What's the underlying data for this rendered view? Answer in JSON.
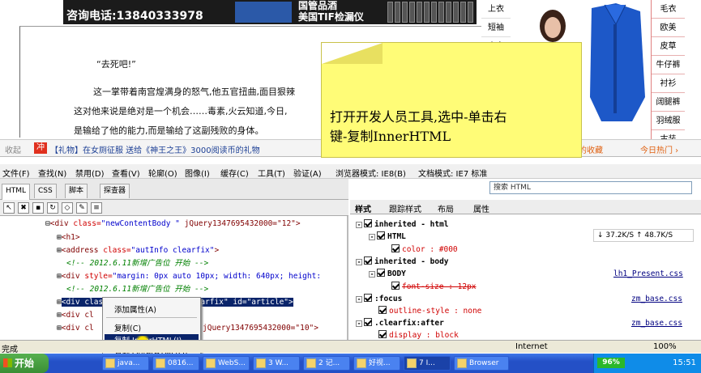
{
  "banner": {
    "phone": "咨询电话:13840333978",
    "text_line1": "国管品酒",
    "text_line2": "美国TIF检漏仪"
  },
  "article": {
    "quote": "“去死吧!”",
    "line1": "这一掌带着南宫煌满身的怒气,他五官扭曲,面目狠辣",
    "line2": "这对他来说是绝对是一个机会……毒素,火云知道,今日,",
    "line3": "是输给了他的能力,而是输给了这副残败的身体。"
  },
  "right_ad": {
    "categories": [
      "上衣",
      "短袖",
      "大衣"
    ],
    "menu": [
      "毛衣",
      "欧美",
      "皮草",
      "牛仔裤",
      "衬衫",
      "阔腿裤",
      "羽绒服",
      "古装"
    ]
  },
  "game_bar": {
    "shou": "收起",
    "chong": "冲",
    "gift_text": "【礼物】在女厕征服 送给《神王之王》3000阅读币的礼物",
    "favorites": "我的收藏",
    "today_hot": "今日热门 ›"
  },
  "devtools": {
    "menu": [
      "文件(F)",
      "查找(N)",
      "禁用(D)",
      "查看(V)",
      "轮廓(O)",
      "图像(I)",
      "缓存(C)",
      "工具(T)",
      "验证(A)",
      "浏览器模式: IE8(B)",
      "文档模式: IE7 标准"
    ],
    "tabs": [
      "HTML",
      "CSS",
      "脚本",
      "探查器"
    ],
    "search_placeholder": "搜索 HTML",
    "right_tabs": [
      "样式",
      "跟踪样式",
      "布局",
      "属性"
    ],
    "dom_lines": [
      {
        "prefix": "⊟",
        "tag": "<div ",
        "attr": "class=",
        "val": "\"newContentBody \"",
        "rest": " jQuery1347695432000=\"12\">"
      },
      {
        "prefix": "⊞",
        "tag": "<h1>",
        "attr": "",
        "val": "",
        "rest": ""
      },
      {
        "prefix": "⊞",
        "tag": "<address ",
        "attr": "class=",
        "val": "\"autInfo clearfix\"",
        "rest": ">"
      },
      {
        "prefix": "",
        "tag": "",
        "attr": "",
        "val": "",
        "rest": "<!-- 2012.6.11新增广告位 开始 -->"
      },
      {
        "prefix": "⊞",
        "tag": "<div ",
        "attr": "style=",
        "val": "\"margin: 0px auto 10px; width: 640px; height:",
        "rest": ""
      },
      {
        "prefix": "",
        "tag": "",
        "attr": "",
        "val": "",
        "rest": "<!-- 2012.6.11新增广告位 开始 -->"
      },
      {
        "prefix": "⊞",
        "tag": "<div ",
        "attr": "class=",
        "val": "\"mainContentNew clearfix\"",
        "rest": " id=\"article\">"
      },
      {
        "prefix": "⊞",
        "tag": "<div cl",
        "attr": "",
        "val": "",
        "rest": ""
      },
      {
        "prefix": "⊞",
        "tag": "<div cl",
        "attr": "",
        "val": "",
        "rest": "jQuery1347695432000=\"10\">"
      }
    ],
    "style_lines": [
      {
        "indent": 0,
        "text": "inherited - html",
        "link": ""
      },
      {
        "indent": 1,
        "text": "HTML",
        "link": ""
      },
      {
        "indent": 2,
        "text": "color : #000",
        "link": ""
      },
      {
        "indent": 0,
        "text": "inherited - body",
        "link": ""
      },
      {
        "indent": 1,
        "text": "BODY",
        "link": "lh1_Present.css"
      },
      {
        "indent": 2,
        "text": "font-size : 12px",
        "link": ""
      },
      {
        "indent": 0,
        "text": ":focus",
        "link": "zm_base.css"
      },
      {
        "indent": 1,
        "text": "outline-style : none",
        "link": ""
      },
      {
        "indent": 0,
        "text": ".clearfix:after",
        "link": "zm_base.css"
      },
      {
        "indent": 1,
        "text": "display : block",
        "link": ""
      }
    ],
    "net_speed": "↓ 37.2K/S ↑ 48.7K/S"
  },
  "context_menu": {
    "items": [
      "添加属性(A)",
      "复制(C)",
      "复制 InnerHTML(I)",
      "复制 OuterHTML(O)"
    ]
  },
  "note": {
    "line1": "打开开发人员工具,选中-单击右",
    "line2": "键-复制InnerHTML"
  },
  "statusbar": {
    "done": "完成",
    "zone": "Internet",
    "zoom": "100%"
  },
  "taskbar": {
    "start": "开始",
    "buttons": [
      "java...",
      "0816...",
      "WebS...",
      "3 W...",
      "2 记...",
      "好视...",
      "7 I...",
      "Browser"
    ],
    "battery": "96%",
    "clock": "15:51"
  }
}
